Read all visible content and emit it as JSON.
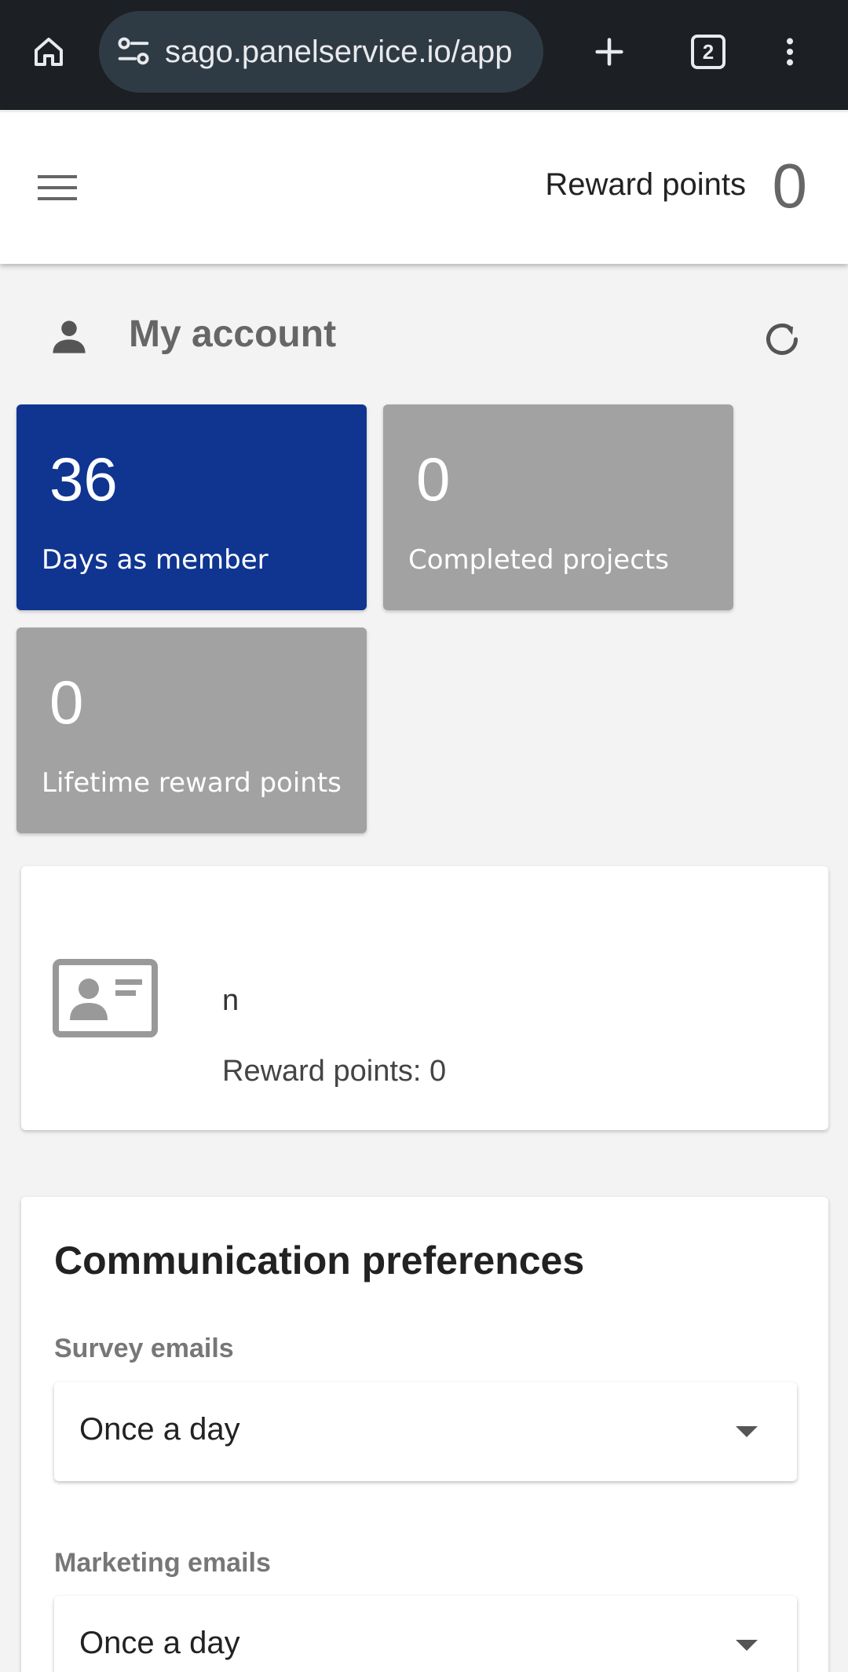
{
  "browser": {
    "url": "sago.panelservice.io/app",
    "tab_count": "2",
    "icons": [
      "home-icon",
      "site-info-icon",
      "new-tab-icon",
      "tab-switcher-icon",
      "more-vert-icon"
    ]
  },
  "header": {
    "reward_label": "Reward points",
    "reward_value": "0",
    "icons": [
      "menu-icon"
    ]
  },
  "account": {
    "title": "My account",
    "icons": [
      "person-icon",
      "refresh-icon"
    ],
    "stats": [
      {
        "value": "36",
        "label": "Days as member",
        "color": "#0f3591"
      },
      {
        "value": "0",
        "label": "Completed projects",
        "color": "#a2a2a2"
      },
      {
        "value": "0",
        "label": "Lifetime reward points",
        "color": "#a2a2a2"
      }
    ]
  },
  "profile": {
    "name": "n",
    "reward_points": "Reward points: 0",
    "icon": "id-card-icon"
  },
  "preferences": {
    "title": "Communication preferences",
    "fields": [
      {
        "label": "Survey emails",
        "value": "Once a day"
      },
      {
        "label": "Marketing emails",
        "value": "Once a day"
      }
    ]
  }
}
